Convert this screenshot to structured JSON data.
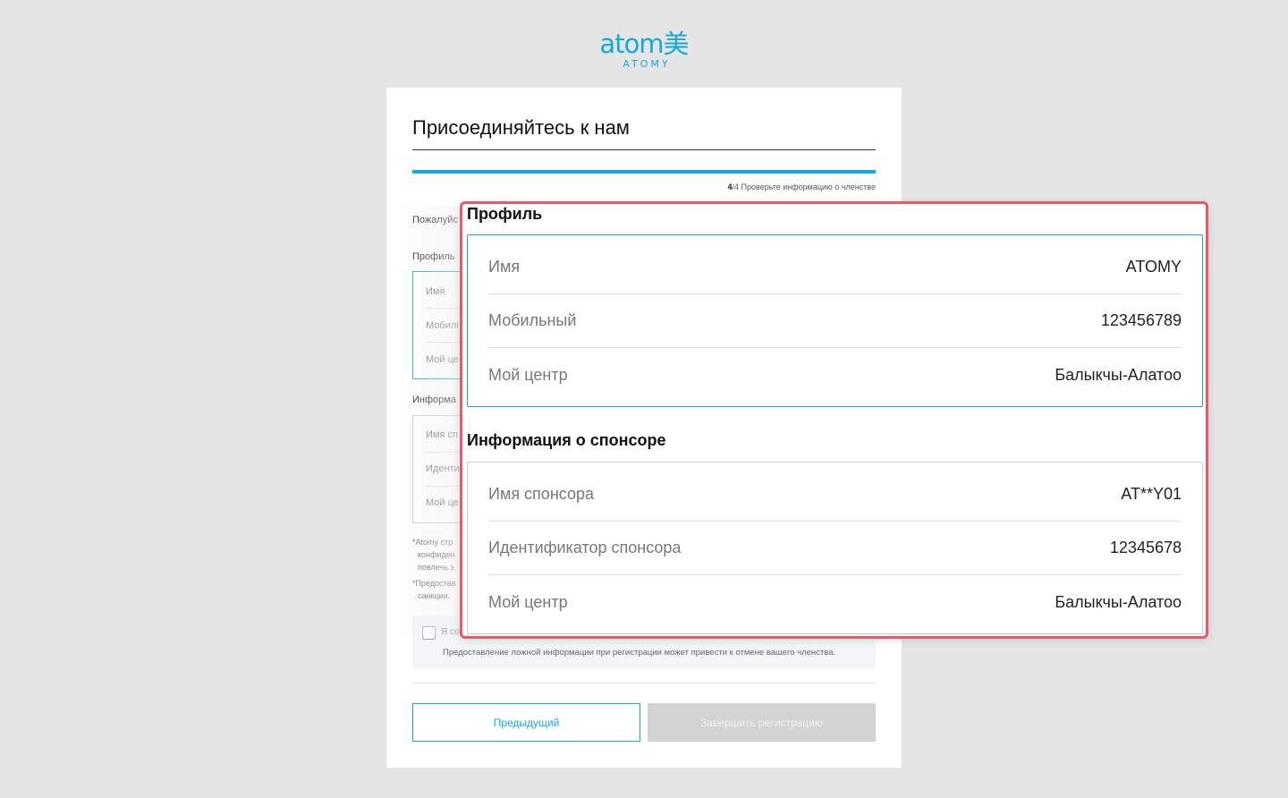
{
  "logo": {
    "main": "atom美",
    "sub": "ATOMY"
  },
  "page": {
    "title": "Присоединяйтесь к нам",
    "step_current": "4",
    "step_total_text": "/4 Проверьте информацию о членстве",
    "intro_partial": "Пожалуйс",
    "profile_label": "Профиль",
    "profile_rows": [
      "Имя",
      "Мобилі",
      "Мой це"
    ],
    "sponsor_label_partial": "Информа",
    "sponsor_rows": [
      "Имя сп",
      "Иденти",
      "Мой це"
    ],
    "note1_lines": [
      "Atomy стр",
      "конфиден",
      "повлечь з"
    ],
    "note2_lines": [
      "Предостав",
      "санкции."
    ],
    "agree_partial": "Я со",
    "agree_warning": "Предоставление ложной информации при регистрации может привести к отмене вашего членства.",
    "btn_prev": "Предыдущий",
    "btn_finish": "Завершить регистрацию"
  },
  "zoom": {
    "profile_heading": "Профиль",
    "profile": [
      {
        "label": "Имя",
        "value": "ATOMY"
      },
      {
        "label": "Мобильный",
        "value": "123456789"
      },
      {
        "label": "Мой центр",
        "value": "Балыкчы-Алатоо"
      }
    ],
    "sponsor_heading": "Информация о спонсоре",
    "sponsor": [
      {
        "label": "Имя спонсора",
        "value": "AT**Y01"
      },
      {
        "label": "Идентификатор спонсора",
        "value": "12345678"
      },
      {
        "label": "Мой центр",
        "value": "Балыкчы-Алатоо"
      }
    ]
  },
  "colors": {
    "accent": "#14a9d7",
    "highlight": "#e85a68"
  }
}
